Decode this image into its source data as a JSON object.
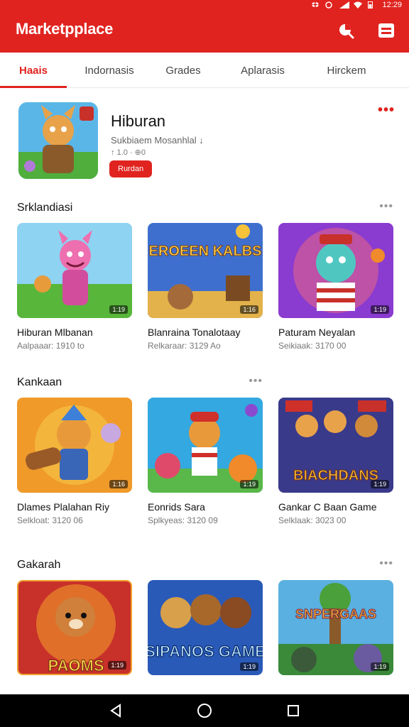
{
  "app": {
    "title": "Marketpplace"
  },
  "status": {
    "time": "12:29"
  },
  "tabs": [
    {
      "label": "Haais",
      "active": true
    },
    {
      "label": "Indornasis",
      "active": false
    },
    {
      "label": "Grades",
      "active": false
    },
    {
      "label": "Aplarasis",
      "active": false
    },
    {
      "label": "Hirckem",
      "active": false
    }
  ],
  "featured": {
    "title": "Hiburan",
    "subtitle": "Sukbiaem Mosanhlal ↓",
    "meta": "↑ 1.0 · ⊕0",
    "button": "Rurdan"
  },
  "sections": [
    {
      "title": "Srklandiasi",
      "cards": [
        {
          "name": "Hiburan Mlbanan",
          "meta": "Aalpaaar: 1910 to",
          "badge": "1:19"
        },
        {
          "name": "Blanraina Tonalotaay",
          "meta": "Relkaraar: 3129 Ao",
          "badge": "1:16"
        },
        {
          "name": "Paturam Neyalan",
          "meta": "Seikiaak: 3170 00",
          "badge": "1:19"
        }
      ]
    },
    {
      "title": "Kankaan",
      "cards": [
        {
          "name": "Dlames Plalahan Riy",
          "meta": "Selkloat: 3120 06",
          "badge": "1:16"
        },
        {
          "name": "Eonrids Sara",
          "meta": "Splkyeas: 3120 09",
          "badge": "1:19"
        },
        {
          "name": "Gankar C Baan Game",
          "meta": "Selklaak: 3023 00",
          "badge": "1:19"
        }
      ]
    },
    {
      "title": "Gakarah",
      "cards": [
        {
          "name": "",
          "meta": "",
          "badge": "1:19"
        },
        {
          "name": "",
          "meta": "",
          "badge": "1:19"
        },
        {
          "name": "",
          "meta": "",
          "badge": "1:19"
        }
      ]
    }
  ],
  "art_texts": {
    "s1c2": "EROEEN KALBS",
    "s2c3": "BIACHDANS",
    "s3c1": "PAOMS",
    "s3c2": "SIPANOS GAME",
    "s3c3": "SNPERGAAS"
  },
  "icons": {
    "search": "search-icon",
    "menu": "menu-icon",
    "back": "back-icon",
    "home": "home-icon",
    "recents": "recents-icon"
  },
  "colors": {
    "brand": "#e0231f"
  }
}
